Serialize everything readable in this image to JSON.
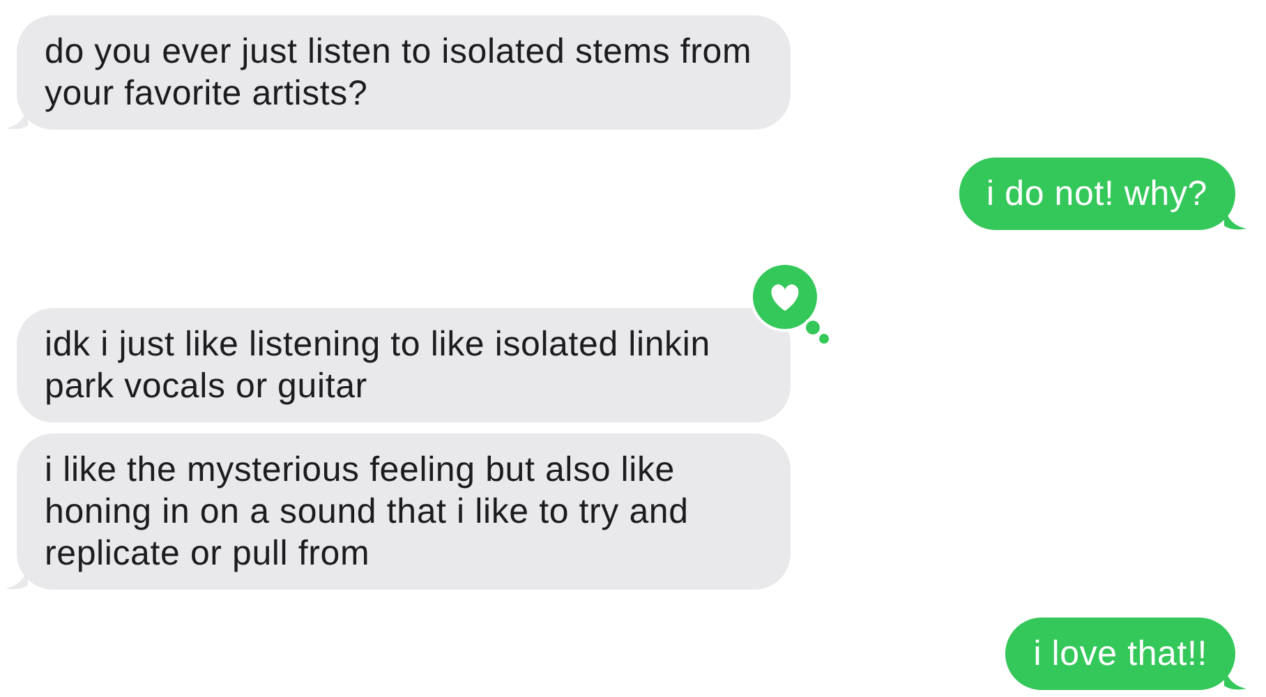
{
  "messages": [
    {
      "kind": "incoming",
      "text": "do you ever just listen to isolated stems from your favorite artists?",
      "tail": true,
      "hearted": false
    },
    {
      "kind": "outgoing",
      "text": "i do not! why?",
      "tail": true,
      "hearted": false
    },
    {
      "kind": "incoming",
      "text": "idk i just like listening to like isolated linkin park vocals or guitar",
      "tail": false,
      "hearted": true
    },
    {
      "kind": "incoming",
      "text": "i like the mysterious feeling but also like honing in on a sound that i like to try and replicate or pull from",
      "tail": true,
      "hearted": false
    },
    {
      "kind": "outgoing",
      "text": "i love that!!",
      "tail": true,
      "hearted": false
    }
  ]
}
